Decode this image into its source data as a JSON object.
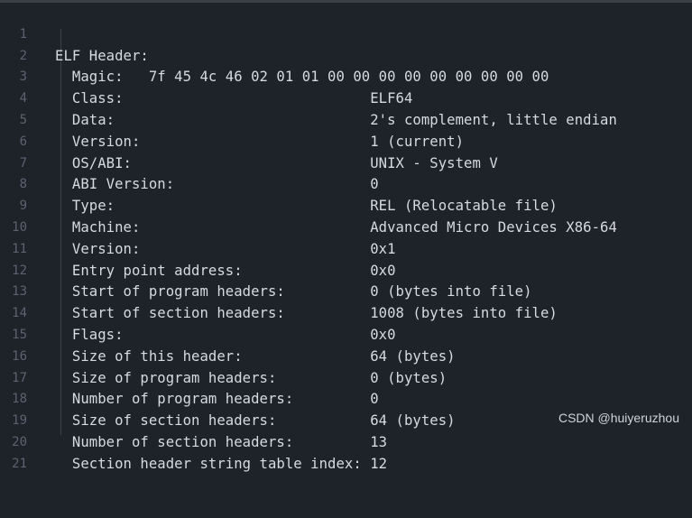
{
  "editor": {
    "lines": [
      {
        "num": "1",
        "text": "ELF Header:"
      },
      {
        "num": "2",
        "text": "  Magic:   7f 45 4c 46 02 01 01 00 00 00 00 00 00 00 00 00"
      },
      {
        "num": "3",
        "text": "  Class:                             ELF64"
      },
      {
        "num": "4",
        "text": "  Data:                              2's complement, little endian"
      },
      {
        "num": "5",
        "text": "  Version:                           1 (current)"
      },
      {
        "num": "6",
        "text": "  OS/ABI:                            UNIX - System V"
      },
      {
        "num": "7",
        "text": "  ABI Version:                       0"
      },
      {
        "num": "8",
        "text": "  Type:                              REL (Relocatable file)"
      },
      {
        "num": "9",
        "text": "  Machine:                           Advanced Micro Devices X86-64"
      },
      {
        "num": "10",
        "text": "  Version:                           0x1"
      },
      {
        "num": "11",
        "text": "  Entry point address:               0x0"
      },
      {
        "num": "12",
        "text": "  Start of program headers:          0 (bytes into file)"
      },
      {
        "num": "13",
        "text": "  Start of section headers:          1008 (bytes into file)"
      },
      {
        "num": "14",
        "text": "  Flags:                             0x0"
      },
      {
        "num": "15",
        "text": "  Size of this header:               64 (bytes)"
      },
      {
        "num": "16",
        "text": "  Size of program headers:           0 (bytes)"
      },
      {
        "num": "17",
        "text": "  Number of program headers:         0"
      },
      {
        "num": "18",
        "text": "  Size of section headers:           64 (bytes)"
      },
      {
        "num": "19",
        "text": "  Number of section headers:         13"
      },
      {
        "num": "20",
        "text": "  Section header string table index: 12"
      },
      {
        "num": "21",
        "text": ""
      }
    ]
  },
  "watermark": "CSDN @huiyeruzhou",
  "colors": {
    "background": "#1e2229",
    "text": "#d7dae0",
    "line_number": "#5c6370"
  }
}
